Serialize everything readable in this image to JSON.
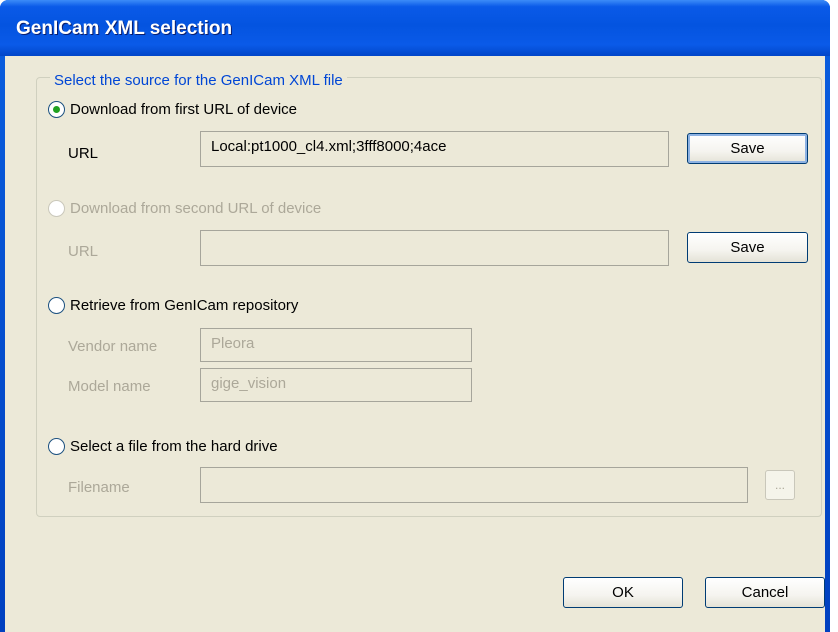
{
  "window": {
    "title": "GenICam XML selection"
  },
  "group": {
    "legend": "Select the source for the GenICam XML file"
  },
  "options": {
    "first_url": {
      "label": "Download from first URL of device",
      "checked": true,
      "url_label": "URL",
      "url_value": "Local:pt1000_cl4.xml;3fff8000;4ace",
      "save_label": "Save"
    },
    "second_url": {
      "label": "Download from second URL of device",
      "enabled": false,
      "url_label": "URL",
      "url_value": "",
      "save_label": "Save"
    },
    "repository": {
      "label": "Retrieve from GenICam repository",
      "vendor_label": "Vendor name",
      "vendor_value": "Pleora",
      "model_label": "Model name",
      "model_value": "gige_vision"
    },
    "file": {
      "label": "Select a file from the hard drive",
      "filename_label": "Filename",
      "filename_value": "",
      "browse_label": "..."
    }
  },
  "buttons": {
    "ok": "OK",
    "cancel": "Cancel"
  }
}
